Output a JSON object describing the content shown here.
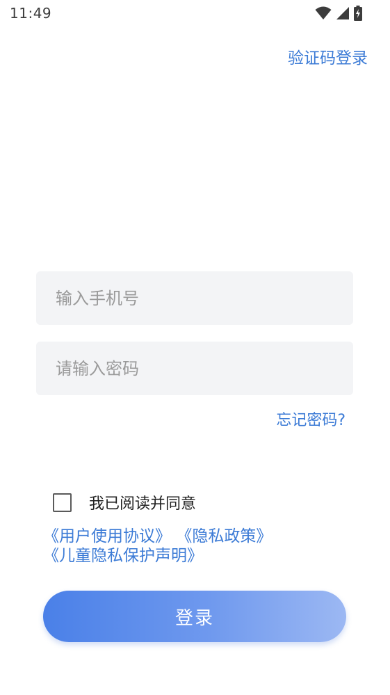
{
  "status_bar": {
    "time": "11:49",
    "icons": [
      "wifi-icon",
      "signal-icon",
      "battery-charging-icon"
    ]
  },
  "header": {
    "sms_login_label": "验证码登录"
  },
  "form": {
    "phone_placeholder": "输入手机号",
    "password_placeholder": "请输入密码",
    "forgot_password_label": "忘记密码?"
  },
  "agreement": {
    "checked": false,
    "text": "我已阅读并同意",
    "user_agreement": "《用户使用协议》",
    "privacy_policy": "《隐私政策》",
    "child_privacy": "《儿童隐私保护声明》"
  },
  "login_button": {
    "label": "登录"
  },
  "colors": {
    "link": "#3c7bd6",
    "input_bg": "#f3f4f6",
    "button_gradient_start": "#4a80e8",
    "button_gradient_end": "#9cb8f3"
  }
}
